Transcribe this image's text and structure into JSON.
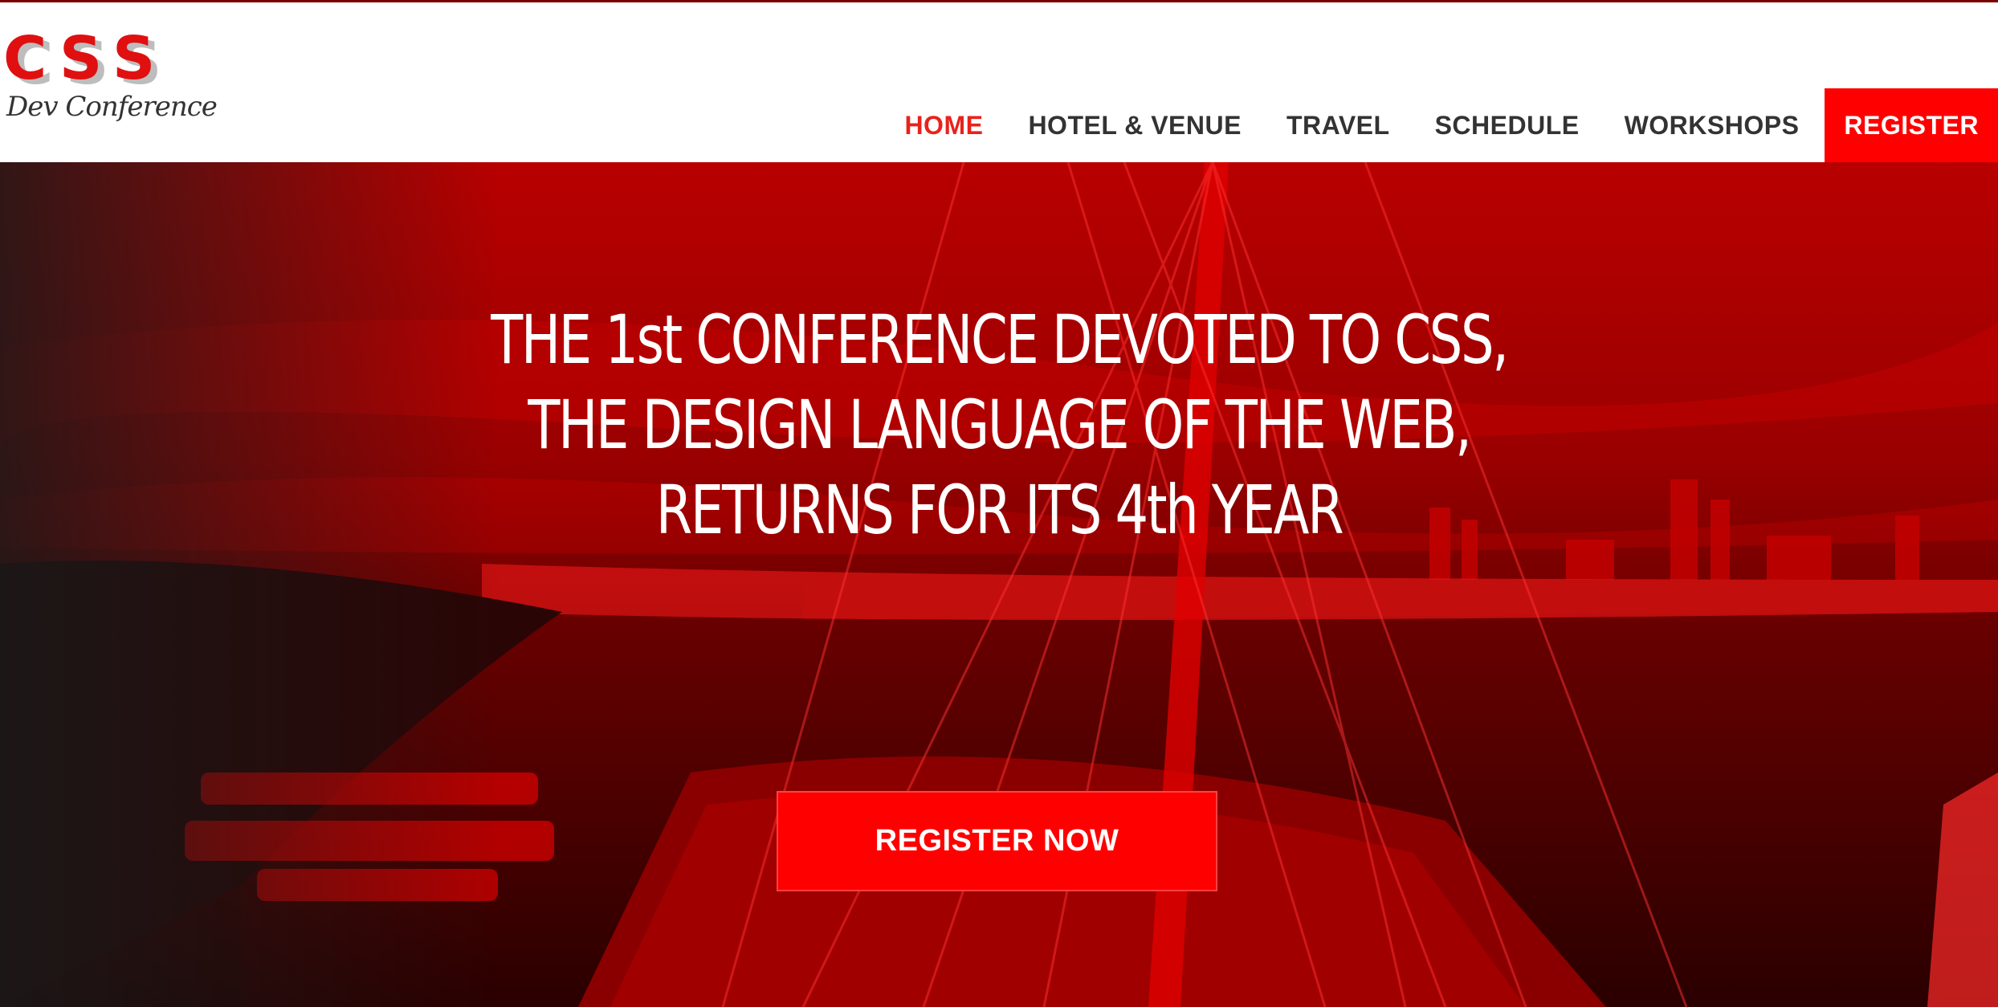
{
  "brand": {
    "logo_letters": [
      "C",
      "S",
      "S"
    ],
    "logo_subtitle": "Dev Conference",
    "accent_color": "#ff0000",
    "topline_color": "#7a0000"
  },
  "nav": {
    "items": [
      {
        "label": "HOME",
        "active": true
      },
      {
        "label": "HOTEL & VENUE",
        "active": false
      },
      {
        "label": "TRAVEL",
        "active": false
      },
      {
        "label": "SCHEDULE",
        "active": false
      },
      {
        "label": "WORKSHOPS",
        "active": false
      },
      {
        "label": "REGISTER",
        "active": false
      }
    ]
  },
  "hero": {
    "headline_lines": [
      "THE 1st CONFERENCE DEVOTED TO CSS,",
      "THE DESIGN LANGUAGE OF THE WEB,",
      "RETURNS FOR ITS 4th YEAR"
    ],
    "cta_label": "REGISTER NOW",
    "background_description_color": "#b00000"
  }
}
